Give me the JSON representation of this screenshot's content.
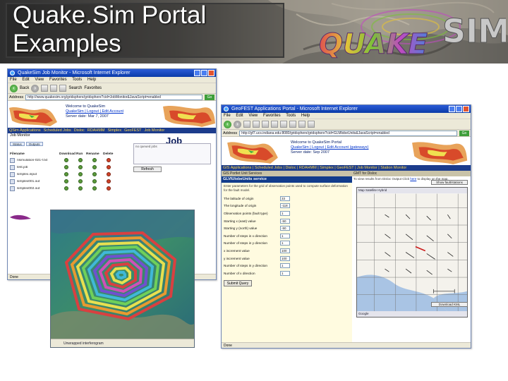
{
  "slide": {
    "title": "Quake.Sim Portal Examples",
    "logo_text": "QUAKESIM"
  },
  "window_job_monitor": {
    "titlebar": "QuakeSim Job Monitor - Microsoft Internet Explorer",
    "menu": [
      "File",
      "Edit",
      "View",
      "Favorites",
      "Tools",
      "Help"
    ],
    "toolbar": {
      "back": "Back",
      "search": "Search",
      "favorites": "Favorites"
    },
    "address_label": "Address",
    "address": "http://www.quakesim.org/gridsphere/gridsphere?cid=JobMonitor&JavaScript=enabled",
    "go_label": "Go",
    "welcome_line1": "Welcome to QuakeSim",
    "welcome_line2": "QuakeSim | Logout | Edit Account",
    "welcome_line3": "Server date: Mar 7, 2007",
    "nav_items": [
      "QSim Applications",
      "Scheduled Jobs",
      "Disloc",
      "RDAHMM",
      "Simplex",
      "GeoFEST",
      "Job Monitor"
    ],
    "left_heading": "Job Monitor",
    "tabs": [
      "Status",
      "Outputs"
    ],
    "page_heading": "Job Monitor",
    "columns": [
      "Filename",
      "Download",
      "Run",
      "Rename",
      "Delete"
    ],
    "rows": [
      {
        "name": "nsimulation-021-f.txt"
      },
      {
        "name": "test.job"
      },
      {
        "name": "simplex.input"
      },
      {
        "name": "simplex001.out"
      },
      {
        "name": "simplex002.out"
      }
    ],
    "side_box_text": "no queued jobs",
    "refresh_label": "Refresh",
    "status": "Done"
  },
  "insar_image": {
    "caption": "Unwrapped interferogram"
  },
  "window_disloc": {
    "titlebar": "GeoFEST Applications Portal - Microsoft Internet Explorer",
    "menu": [
      "File",
      "Edit",
      "View",
      "Favorites",
      "Tools",
      "Help"
    ],
    "address_label": "Address",
    "address": "http://gf7.ucs.indiana.edu:8080/gridsphere/gridsphere?cid=GLMlobeUnits&JavaScript=enabled",
    "go_label": "Go",
    "welcome_line1": "Welcome to QuakeSim Portal",
    "welcome_line2": "QuakeSim | Logout | Edit Account (gatewayx)",
    "welcome_line3": "Server date: Sep 2007",
    "nav": "GIS Applications | Scheduled Jobs | Disloc | RDAHMM | Simplex | GeoFEST | Job Monitor | Station Monitor",
    "left_header": "GIS Portlet Unit Services",
    "left_subheader": "GLVIUlobeUnits service",
    "left_description": "Enter parameters for the grid of observation points used to compute surface deformation for the fault model.",
    "form": [
      {
        "label": "The latitude of origin",
        "value": "33"
      },
      {
        "label": "The longitude of origin",
        "value": "-118"
      },
      {
        "label": "Observation points (fault type)",
        "value": "1"
      },
      {
        "label": "Starting x (east) value",
        "value": "-50"
      },
      {
        "label": "Starting y (north) value",
        "value": "-50"
      },
      {
        "label": "Number of steps in x direction",
        "value": "1"
      },
      {
        "label": "Number of steps in y direction",
        "value": "1"
      },
      {
        "label": "x increment value",
        "value": "100"
      },
      {
        "label": "y increment value",
        "value": "100"
      },
      {
        "label": "Number of steps in y direction",
        "value": "1"
      },
      {
        "label": "Number of x direction",
        "value": "1"
      }
    ],
    "submit_label": "Submit Query",
    "right_header": "GMT for Disloc",
    "right_note_prefix": "To view results from Disloc Output Click ",
    "right_note_link": "here",
    "right_note_suffix": " to display on the map.",
    "map_toolbar": "Map  Satellite  Hybrid",
    "ipad_button": "Show fault/stations",
    "kml_button": "Download KML",
    "map_bottom": "Google",
    "status": "Done"
  },
  "colors": {
    "xp_titlebar": "#0a3aa8",
    "portal_nav": "#1c3c8c",
    "form_bg": "#fffbe0",
    "logo_green": "#7bbf3a",
    "logo_magenta": "#c04bc0"
  }
}
